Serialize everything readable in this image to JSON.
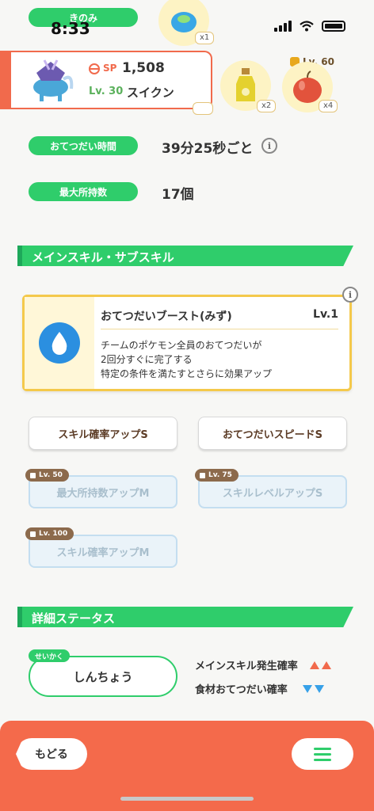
{
  "status_bar": {
    "time": "8:33"
  },
  "top": {
    "kinomi_label": "きのみ",
    "berry_count": "x1",
    "ingredient_counts": [
      "x1",
      "x2",
      "x4"
    ],
    "lock_level": "Lv. 60"
  },
  "pokemon": {
    "sp_label": "SP",
    "sp_value": "1,508",
    "level": "Lv. 30",
    "name": "スイクン"
  },
  "info": {
    "help_time_label": "おてつだい時間",
    "help_time_value": "39分25秒ごと",
    "max_carry_label": "最大所持数",
    "max_carry_value": "17個",
    "info_icon": "i"
  },
  "skills_section": {
    "title": "メインスキル・サブスキル",
    "main_skill": {
      "name": "おてつだいブースト(みず)",
      "level": "Lv.1",
      "description": [
        "チームのポケモン全員のおてつだいが",
        "2回分すぐに完了する",
        "特定の条件を満たすとさらに効果アップ"
      ]
    },
    "sub_skills": [
      {
        "label": "スキル確率アップS"
      },
      {
        "label": "おてつだいスピードS"
      },
      {
        "label": "最大所持数アップM",
        "lock": "Lv. 50"
      },
      {
        "label": "スキルレベルアップS",
        "lock": "Lv. 75"
      },
      {
        "label": "スキル確率アップM",
        "lock": "Lv. 100"
      }
    ]
  },
  "status_section": {
    "title": "詳細ステータス",
    "nature_tag": "せいかく",
    "nature": "しんちょう",
    "up_effect": "メインスキル発生確率",
    "down_effect": "食材おてつだい確率"
  },
  "bottom_bar": {
    "back_label": "もどる"
  },
  "colors": {
    "accent_green": "#2fcd6b",
    "accent_red": "#f46a4b",
    "skill_gold": "#f4c94b",
    "water_blue": "#2b8fe0"
  }
}
